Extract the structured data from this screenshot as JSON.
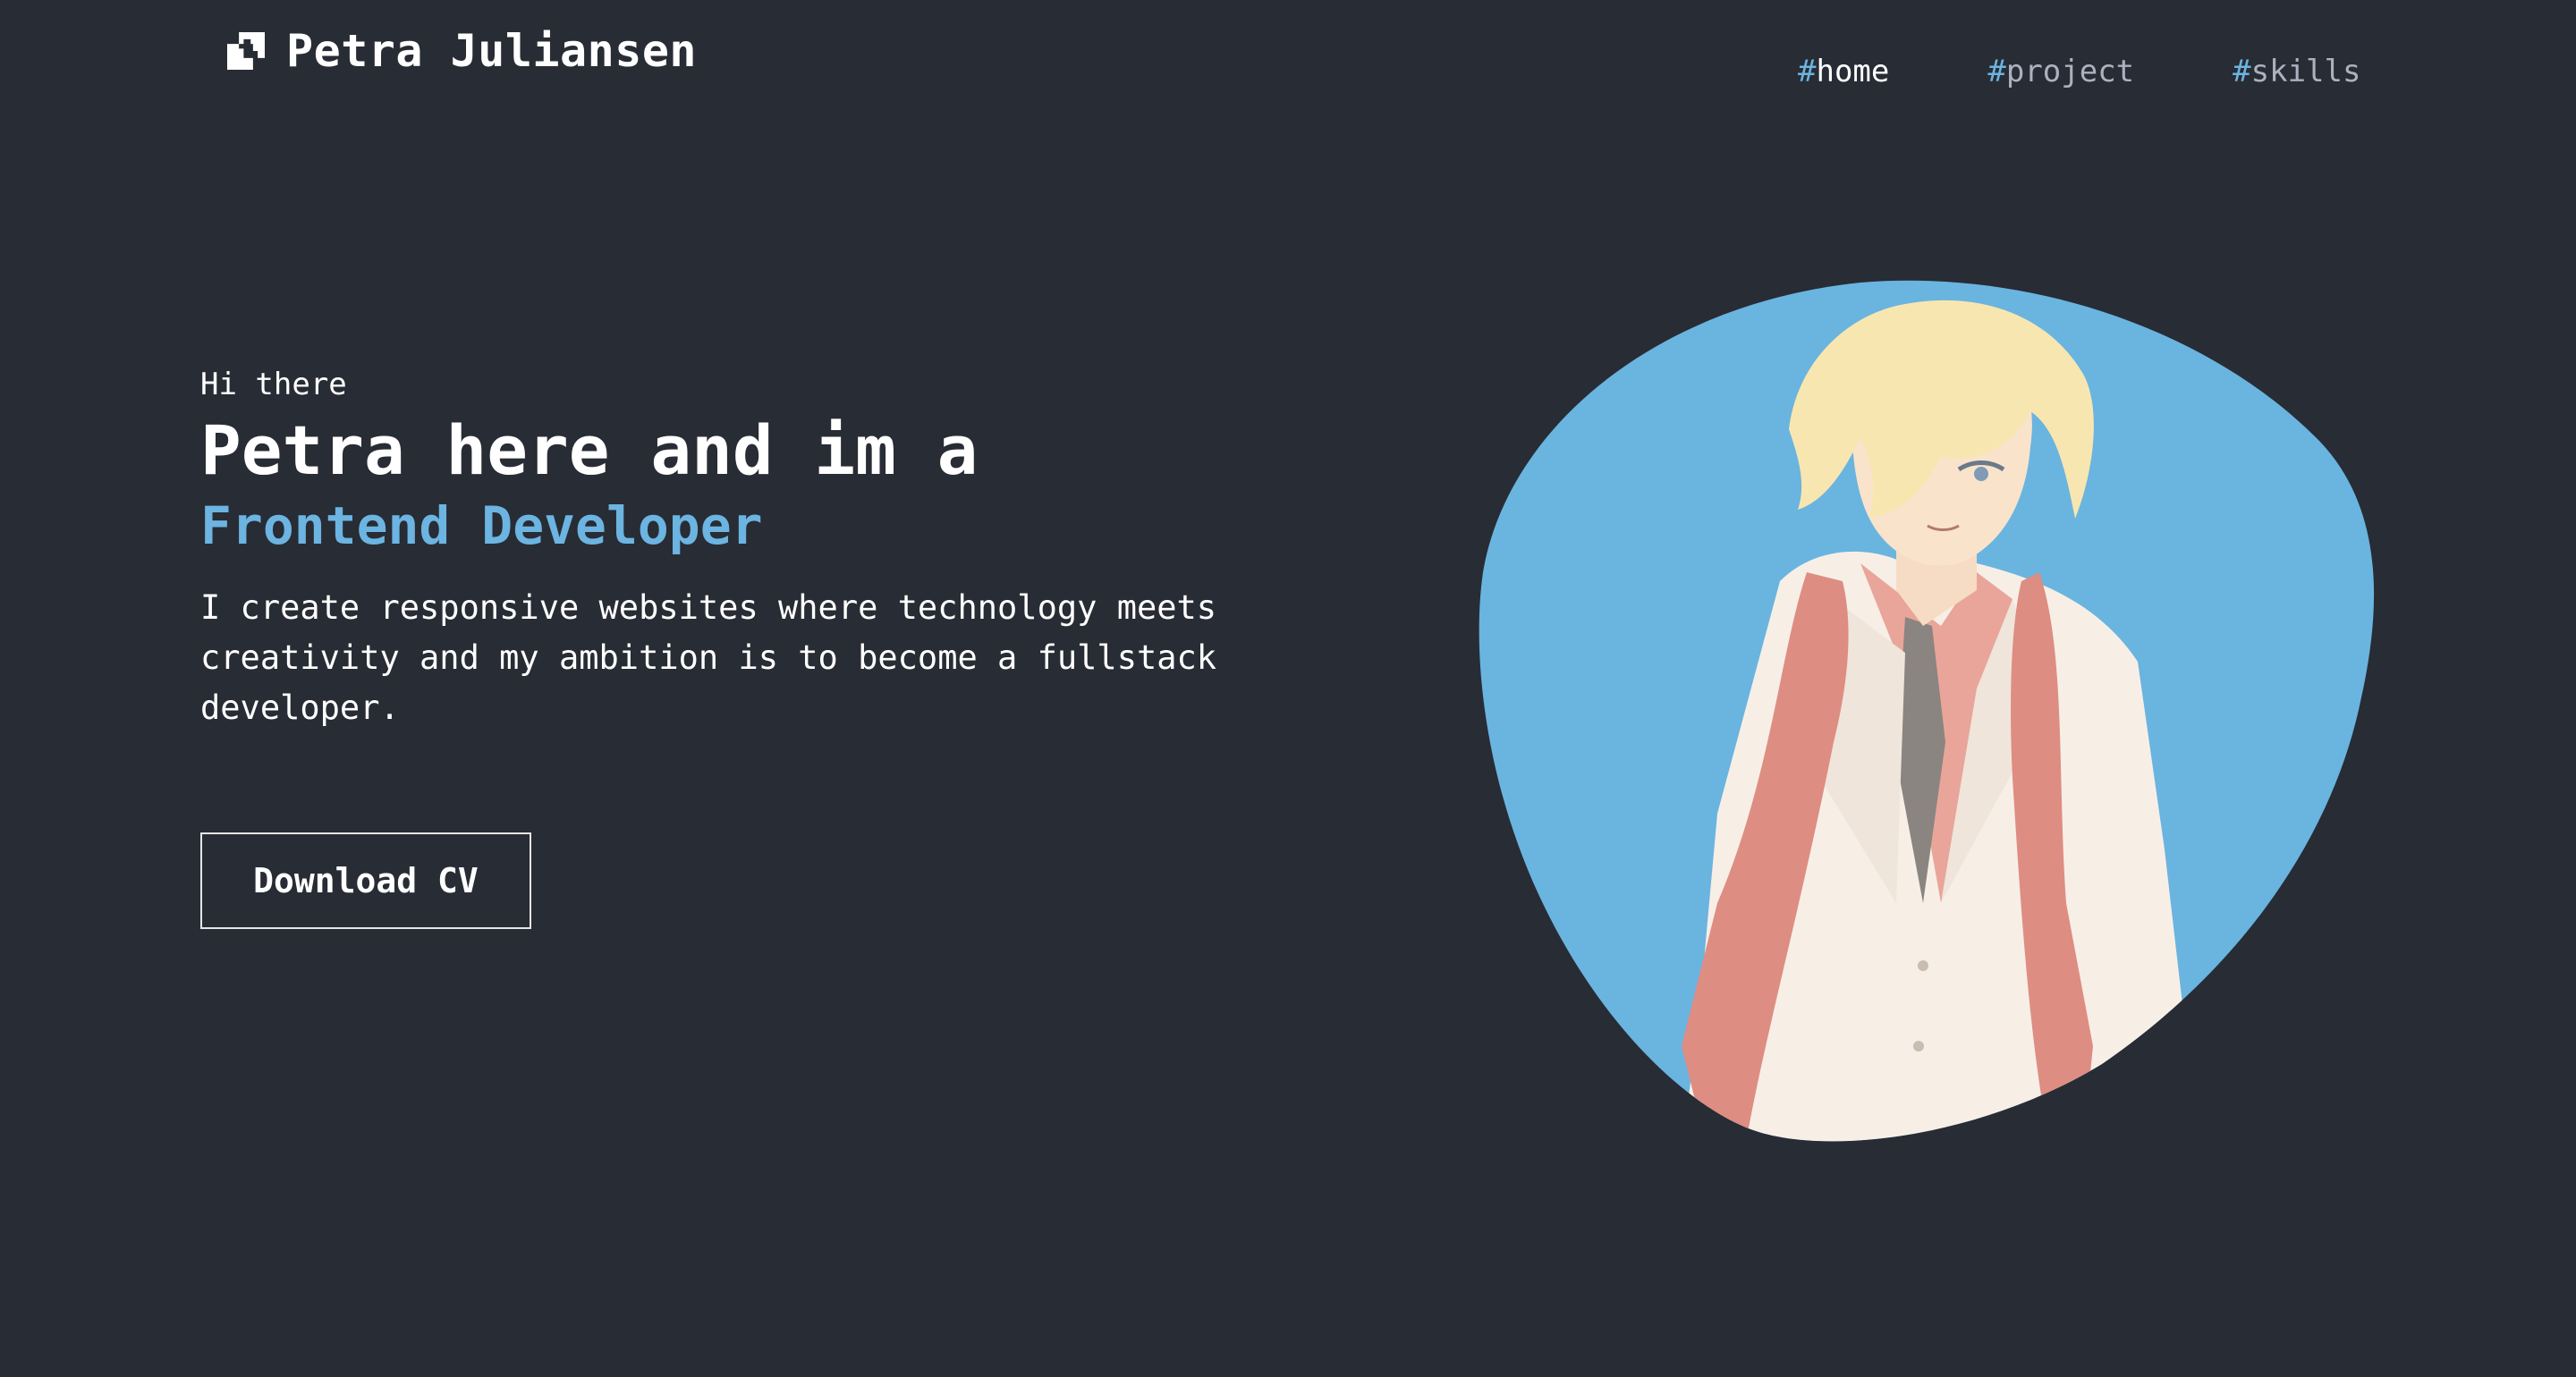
{
  "header": {
    "brand_name": "Petra Juliansen",
    "logo_icon": "pixel-logo-icon",
    "nav": [
      {
        "hash": "#",
        "label": "home",
        "active": true
      },
      {
        "hash": "#",
        "label": "project",
        "active": false
      },
      {
        "hash": "#",
        "label": "skills",
        "active": false
      }
    ]
  },
  "hero": {
    "greeting": "Hi there",
    "headline": "Petra here and im a",
    "role": "Frontend Developer",
    "bio": "I create responsive websites where technology meets creativity and my ambition is to become a fullstack developer.",
    "cv_button_label": "Download CV",
    "portrait": "anime-character-portrait"
  },
  "colors": {
    "background": "#282c34",
    "accent": "#6cb4e1",
    "text": "#ffffff",
    "muted": "#abb2bf",
    "blob": "#6ab4e0"
  }
}
